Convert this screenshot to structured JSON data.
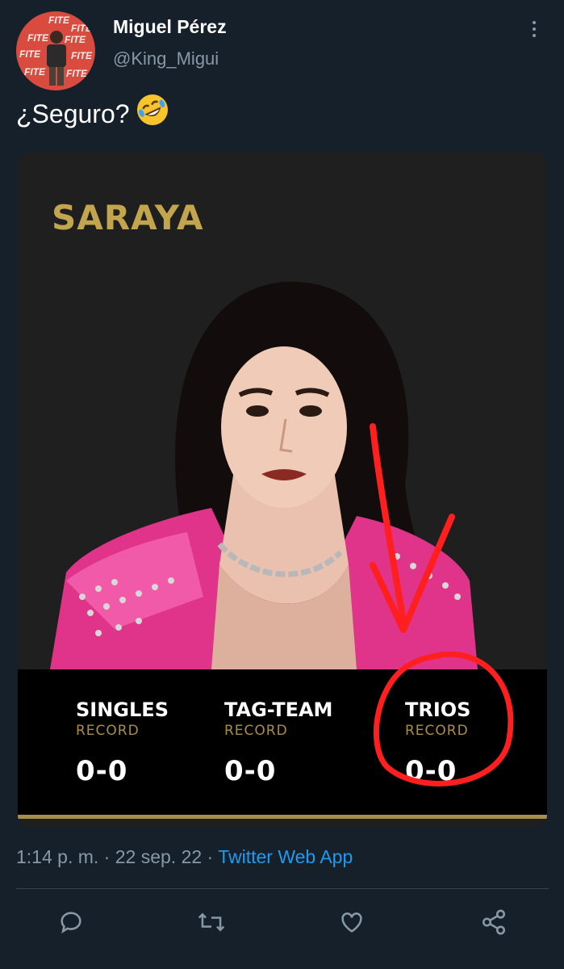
{
  "author": {
    "display_name": "Miguel Pérez",
    "handle": "@King_Migui",
    "avatar_text": "FITE"
  },
  "tweet": {
    "text": "¿Seguro?",
    "emoji": "rolling-on-floor-laughing-emoji"
  },
  "card": {
    "wrestler_name": "SARAYA",
    "records": [
      {
        "label": "SINGLES",
        "sub": "RECORD",
        "value": "0-0"
      },
      {
        "label": "TAG-TEAM",
        "sub": "RECORD",
        "value": "0-0"
      },
      {
        "label": "TRIOS",
        "sub": "RECORD",
        "value": "0-0"
      }
    ],
    "colors": {
      "gold": "#c3a54e",
      "annotation": "#ff2020"
    }
  },
  "meta": {
    "time": "1:14 p. m.",
    "separator": "·",
    "date": "22 sep. 22",
    "source": "Twitter Web App"
  },
  "actions": [
    "reply-icon",
    "retweet-icon",
    "like-icon",
    "share-icon"
  ],
  "colors": {
    "background": "#15202b",
    "secondary_text": "#8899a6",
    "link": "#1d9bf0"
  }
}
